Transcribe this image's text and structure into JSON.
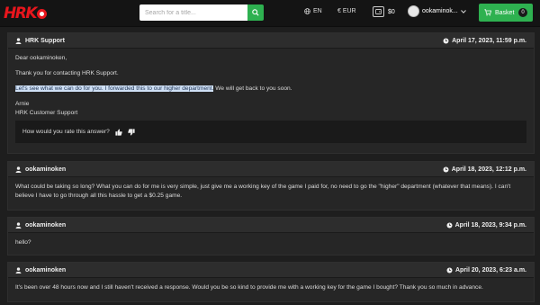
{
  "header": {
    "logo_text": "HRK",
    "search_placeholder": "Search for a title...",
    "language": "EN",
    "currency": "€ EUR",
    "wallet_amount": "$0",
    "username": "ookaminok...",
    "basket_label": "Basket",
    "basket_count": "0"
  },
  "messages": [
    {
      "author": "HRK Support",
      "date": "April 17, 2023, 11:59 p.m.",
      "greeting": "Dear ookaminoken,",
      "line1": "Thank you for contacting HRK Support.",
      "line2_highlight": "Let's see what we can do for you. I forwarded this to our higher department.",
      "line2_rest": " We will get back to you soon.",
      "sign_name": "Arnie",
      "sign_team": "HRK Customer Support",
      "rate_prompt": "How would you rate this answer?"
    },
    {
      "author": "ookaminoken",
      "date": "April 18, 2023, 12:12 p.m.",
      "body": "What could be taking so long? What you can do for me is very simple, just give me a working key of the game I paid for, no need to go the \"higher\" department (whatever that means). I can't believe I have to go through all this hassle to get a $0.25 game."
    },
    {
      "author": "ookaminoken",
      "date": "April 18, 2023, 9:34 p.m.",
      "body": "hello?"
    },
    {
      "author": "ookaminoken",
      "date": "April 20, 2023, 6:23 a.m.",
      "body": "It's been over 48 hours now and I still haven't received a response. Would you be so kind to provide me with a working key for the game I bought? Thank you so much in advance."
    }
  ]
}
